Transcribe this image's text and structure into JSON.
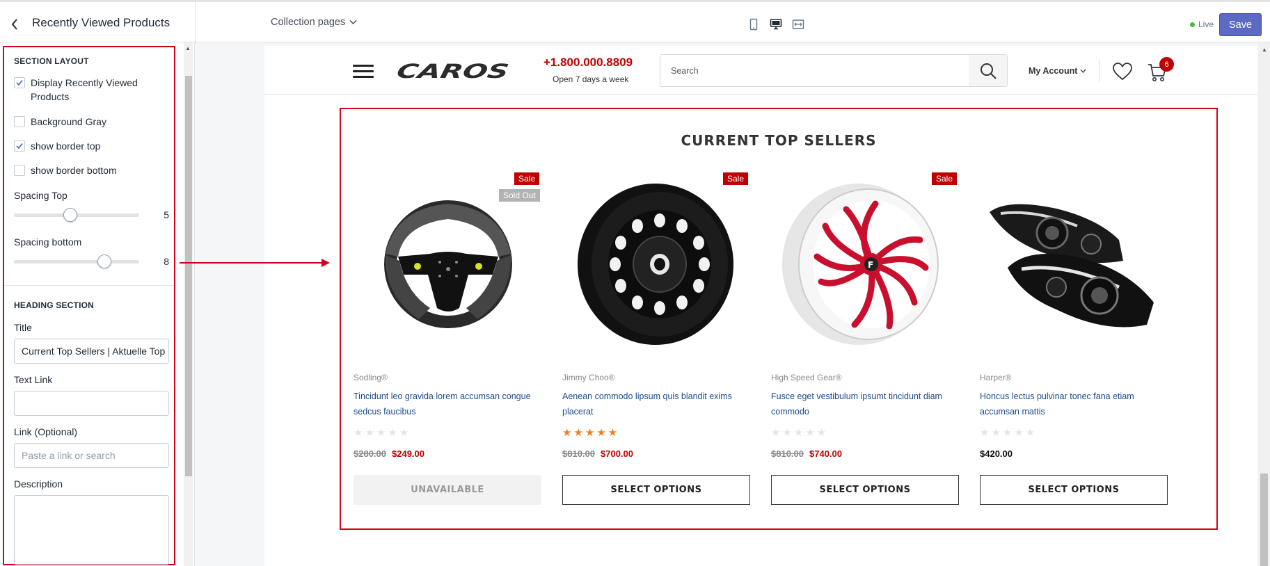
{
  "topbar": {
    "panel_title": "Recently Viewed Products",
    "collection_select": "Collection pages",
    "live_label": "Live",
    "save_label": "Save"
  },
  "settings": {
    "section_layout_heading": "SECTION LAYOUT",
    "checkboxes": [
      {
        "label": "Display Recently Viewed Products",
        "checked": true
      },
      {
        "label": "Background Gray",
        "checked": false
      },
      {
        "label": "show border top",
        "checked": true
      },
      {
        "label": "show border bottom",
        "checked": false
      }
    ],
    "spacing_top": {
      "label": "Spacing Top",
      "value": "5",
      "fraction": 0.45
    },
    "spacing_bottom": {
      "label": "Spacing bottom",
      "value": "8",
      "fraction": 0.72
    },
    "heading_section": "HEADING SECTION",
    "title_label": "Title",
    "title_value": "Current Top Sellers | Aktuelle Top",
    "text_link_label": "Text Link",
    "text_link_value": "",
    "link_label": "Link (Optional)",
    "link_placeholder": "Paste a link or search",
    "description_label": "Description"
  },
  "store": {
    "logo": "CAROS",
    "phone": "+1.800.000.8809",
    "phone_sub": "Open 7 days a week",
    "search_placeholder": "Search",
    "account_label": "My Account",
    "cart_count": "6"
  },
  "section": {
    "title": "CURRENT TOP SELLERS",
    "products": [
      {
        "vendor": "Sodling®",
        "title": "Tincidunt leo gravida lorem accumsan congue sedcus faucibus",
        "rating": 0,
        "old_price": "$280.00",
        "price": "$249.00",
        "badges": [
          "Sale",
          "Sold Out"
        ],
        "button": "UNAVAILABLE",
        "image": "steering-wheel"
      },
      {
        "vendor": "Jimmy Choo®",
        "title": "Aenean commodo lipsum quis blandit exims placerat",
        "rating": 5,
        "old_price": "$810.00",
        "price": "$700.00",
        "badges": [
          "Sale"
        ],
        "button": "SELECT OPTIONS",
        "image": "steel-wheel"
      },
      {
        "vendor": "High Speed Gear®",
        "title": "Fusce eget vestibulum ipsumt tincidunt diam commodo",
        "rating": 0,
        "old_price": "$810.00",
        "price": "$740.00",
        "badges": [
          "Sale"
        ],
        "button": "SELECT OPTIONS",
        "image": "red-rim"
      },
      {
        "vendor": "Harper®",
        "title": "Honcus lectus pulvinar tonec fana etiam accumsan mattis",
        "rating": 0,
        "old_price": "",
        "price": "$420.00",
        "badges": [],
        "button": "SELECT OPTIONS",
        "image": "headlights"
      }
    ]
  },
  "colors": {
    "accent": "#5c6ac4",
    "highlight_red": "#d0021b",
    "price_red": "#c00000",
    "link_blue": "#1a4b8c",
    "star_orange": "#ef7d1a"
  }
}
